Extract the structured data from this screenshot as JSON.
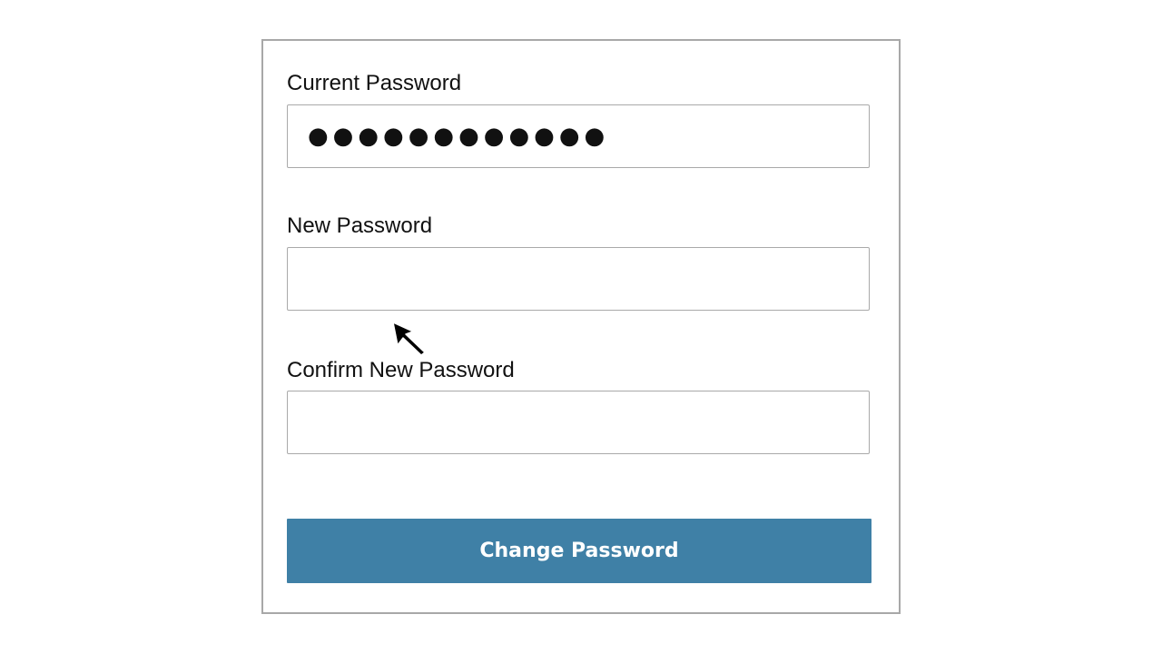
{
  "form": {
    "current_password": {
      "label": "Current Password",
      "value": "●●●●●●●●●●●●"
    },
    "new_password": {
      "label": "New Password",
      "value": ""
    },
    "confirm_password": {
      "label": "Confirm New Password",
      "value": ""
    },
    "submit_label": "Change Password"
  },
  "colors": {
    "accent": "#3f80a6",
    "border": "#a8a8a8"
  },
  "icons": {
    "pointer": "mouse-pointer-icon"
  }
}
